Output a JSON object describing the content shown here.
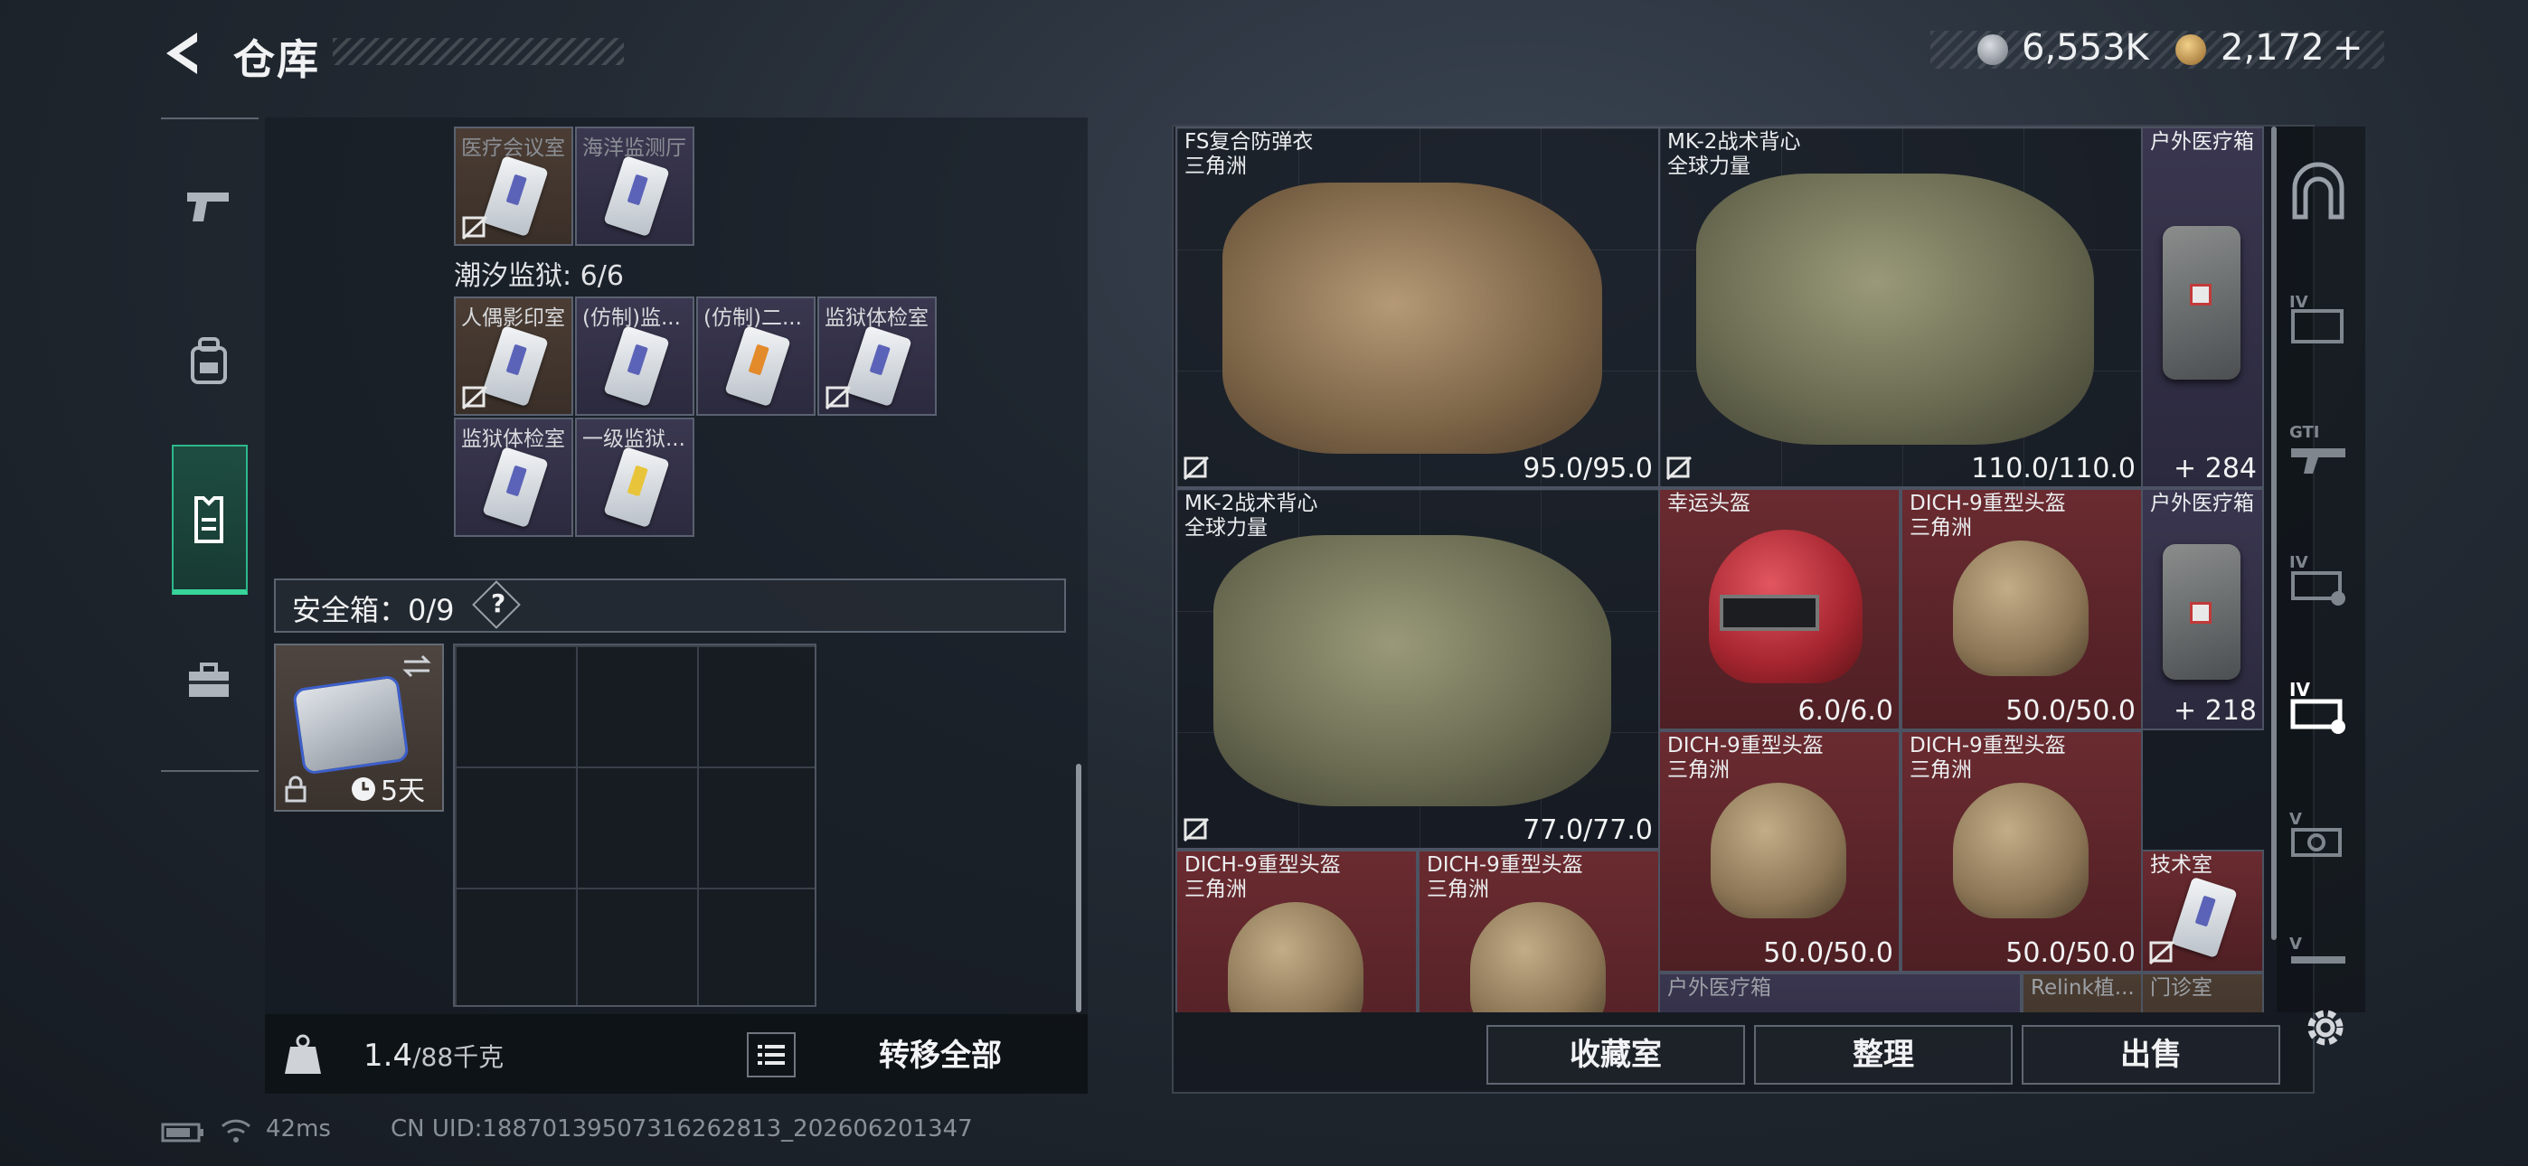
{
  "header": {
    "title": "仓库",
    "currency_silver": "6,553K",
    "currency_gold": "2,172",
    "gold_plus": "+"
  },
  "left_nav": {
    "items": [
      "pistol-icon",
      "backpack-icon",
      "vest-icon",
      "toolbox-icon"
    ],
    "active_index": 2
  },
  "container": {
    "top_row": [
      {
        "label": "医疗会议室",
        "style": "brown"
      },
      {
        "label": "海洋监测厅",
        "style": "purple"
      }
    ],
    "group_label": "潮汐监狱: 6/6",
    "group_row1": [
      {
        "label": "人偶影印室",
        "style": "brown"
      },
      {
        "label": "(仿制)监...",
        "style": "purple"
      },
      {
        "label": "(仿制)二...",
        "style": "purple"
      },
      {
        "label": "监狱体检室",
        "style": "purple"
      }
    ],
    "group_row2": [
      {
        "label": "监狱体检室",
        "style": "purple"
      },
      {
        "label": "一级监狱...",
        "style": "purple"
      }
    ]
  },
  "safebox": {
    "label": "安全箱：0/9",
    "help": "?",
    "timer": "5天"
  },
  "left_footer": {
    "weight_current": "1.4",
    "weight_max": "/88千克",
    "transfer_label": "转移全部"
  },
  "stash": {
    "items": [
      {
        "name": "FS复合防弹衣",
        "sub": "三角洲",
        "value": "95.0/95.0"
      },
      {
        "name": "MK-2战术背心",
        "sub": "全球力量",
        "value": "110.0/110.0"
      },
      {
        "name": "户外医疗箱",
        "sub": "",
        "value": "284"
      },
      {
        "name": "MK-2战术背心",
        "sub": "全球力量",
        "value": "77.0/77.0"
      },
      {
        "name": "幸运头盔",
        "sub": "",
        "value": "6.0/6.0"
      },
      {
        "name": "DICH-9重型头盔",
        "sub": "三角洲",
        "value": "50.0/50.0"
      },
      {
        "name": "户外医疗箱",
        "sub": "",
        "value": "218"
      },
      {
        "name": "DICH-9重型头盔",
        "sub": "三角洲",
        "value": "50.0/50.0"
      },
      {
        "name": "DICH-9重型头盔",
        "sub": "三角洲",
        "value": "50.0/50.0"
      },
      {
        "name": "技术室",
        "sub": "",
        "value": ""
      },
      {
        "name": "DICH-9重型头盔",
        "sub": "三角洲",
        "value": ""
      },
      {
        "name": "DICH-9重型头盔",
        "sub": "三角洲",
        "value": ""
      },
      {
        "name": "户外医疗箱",
        "sub": "",
        "value": ""
      },
      {
        "name": "Relink植...",
        "sub": "",
        "value": ""
      },
      {
        "name": "门诊室",
        "sub": "",
        "value": ""
      }
    ],
    "plus_sign": "+"
  },
  "actions": {
    "collection": "收藏室",
    "organize": "整理",
    "sell": "出售"
  },
  "status_bar": {
    "ping": "42ms",
    "uid": "CN UID:18870139507316262813_202606201347"
  },
  "right_nav": {
    "items": [
      "safe-house-icon",
      "iv-case-icon",
      "gti-rifle-icon",
      "iv-ammo-icon",
      "iv-medkit-icon",
      "v-kit-icon",
      "v-gun-icon"
    ],
    "active_index": 4
  },
  "colors": {
    "accent_green": "#38d49a",
    "red_tier": "#6a2b30",
    "purple_tier": "#3a3650",
    "brown_tier": "#4a3c31"
  }
}
